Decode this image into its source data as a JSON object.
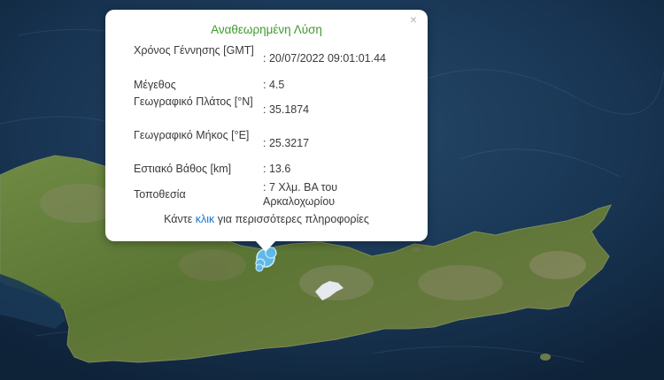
{
  "popup": {
    "title": "Αναθεωρημένη Λύση",
    "close_symbol": "×",
    "rows": [
      {
        "label": "Χρόνος Γέννησης [GMT]",
        "value": ": 20/07/2022 09:01:01.44"
      },
      {
        "label": "Μέγεθος",
        "value": ": 4.5"
      },
      {
        "label": "Γεωγραφικό Πλάτος [°N]",
        "value": ": 35.1874"
      },
      {
        "label": "Γεωγραφικό Μήκος [°E]",
        "value": ": 25.3217"
      },
      {
        "label": "Εστιακό Βάθος [km]",
        "value": ": 13.6"
      },
      {
        "label": "Τοποθεσία",
        "value": ": 7 Χλμ. ΒΑ του Αρκαλοχωρίου"
      }
    ],
    "footer_prefix": "Κάντε",
    "footer_link": "κλικ",
    "footer_suffix": "για περισσότερες πληροφορίες"
  },
  "map": {
    "sea_color": "#1d3d5c",
    "land_color": "#5c7a36",
    "marker_color": "#5fb9e8",
    "marker_icon": "earthquake-marker-icon"
  }
}
